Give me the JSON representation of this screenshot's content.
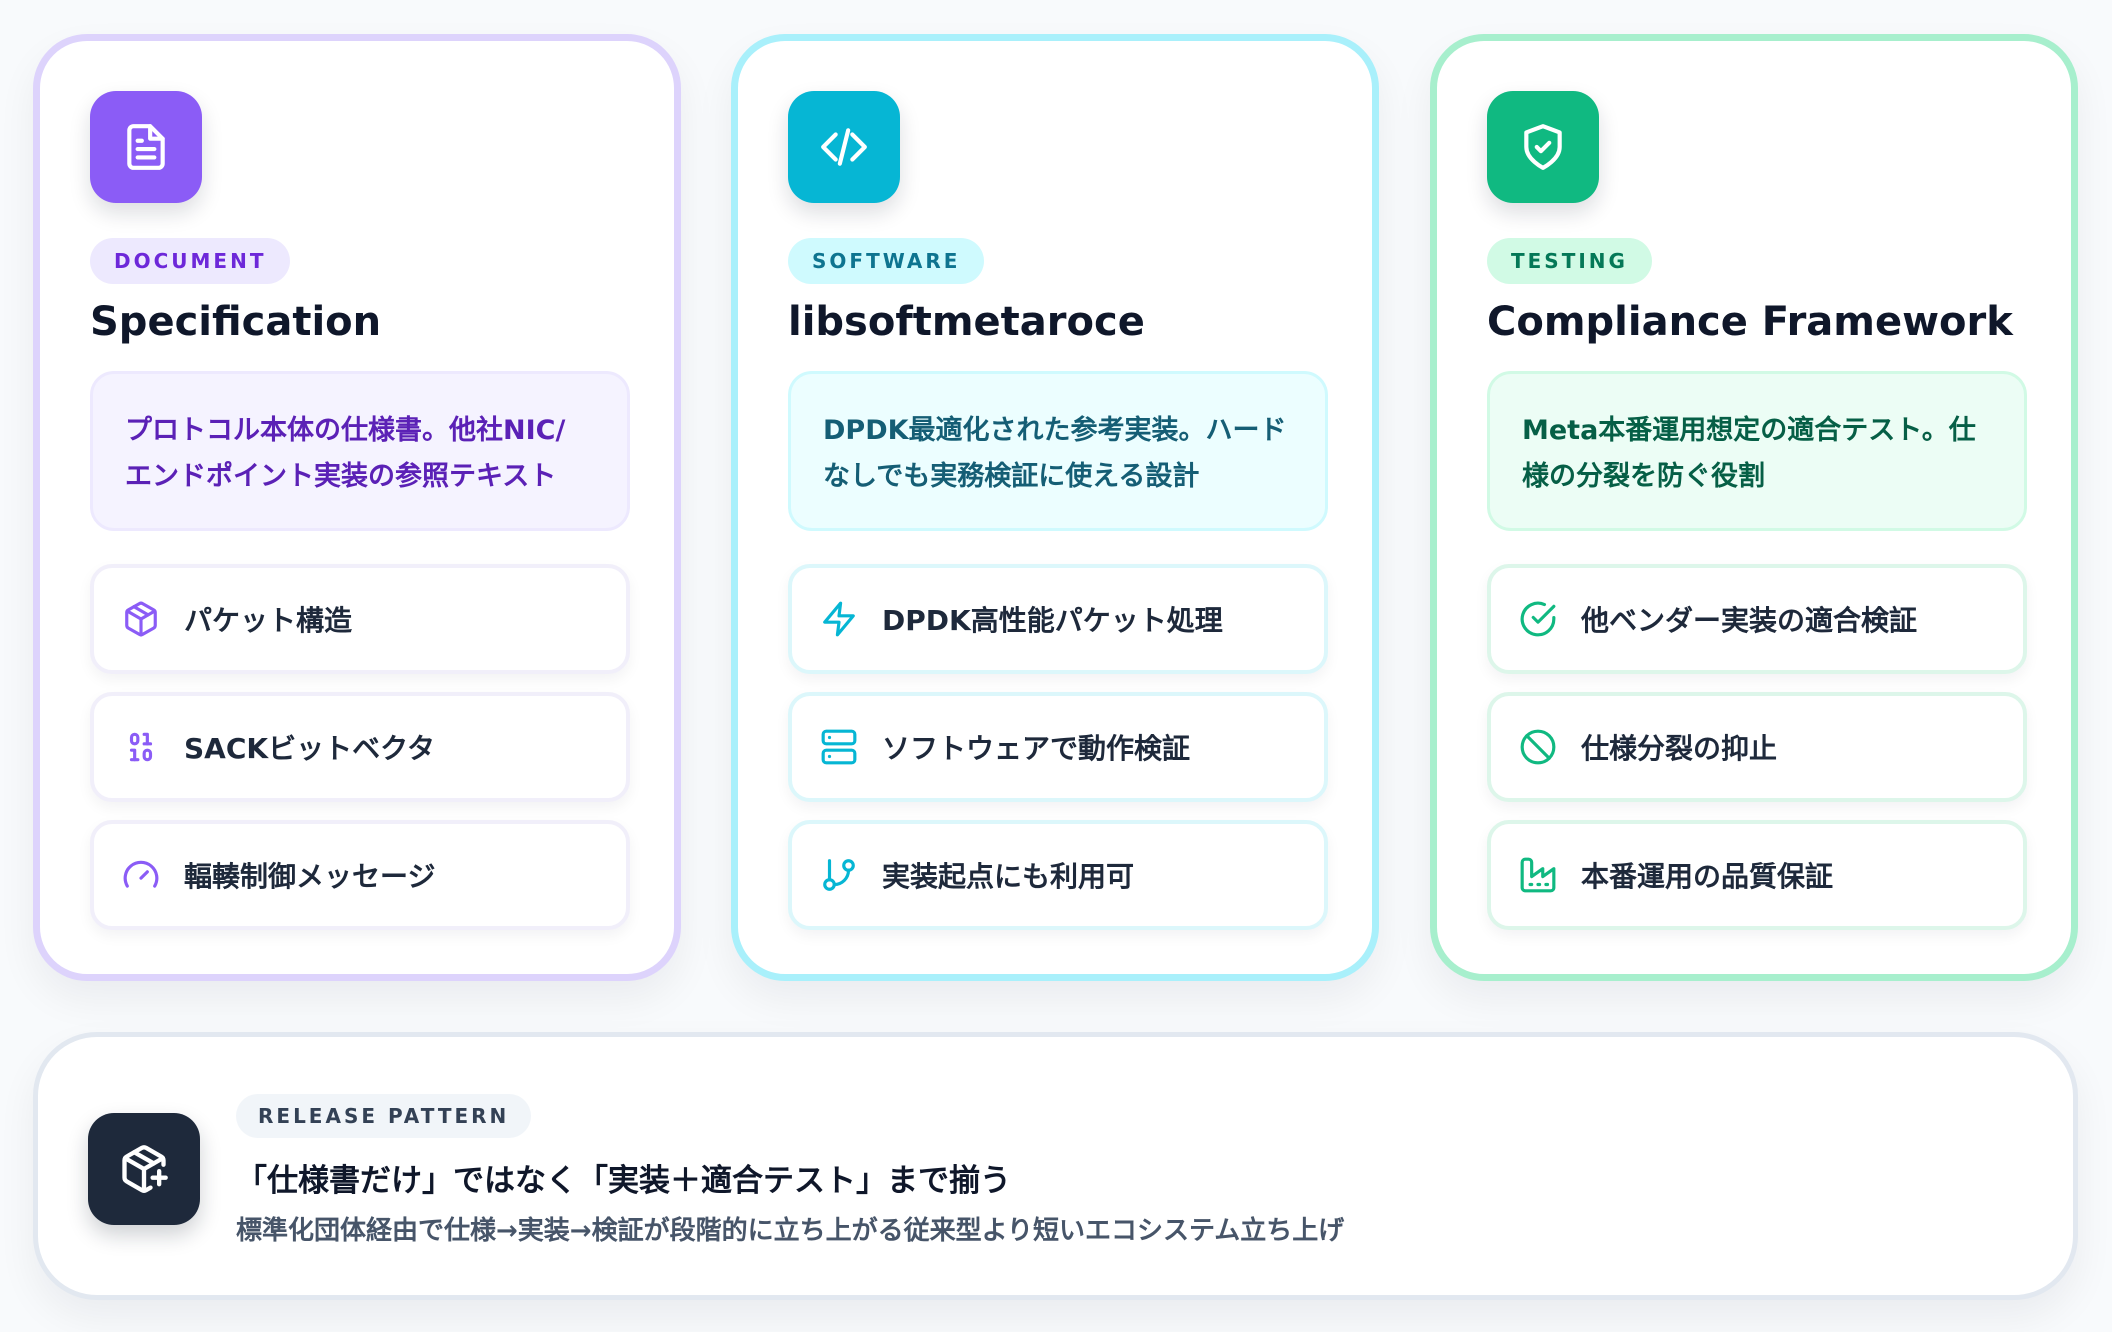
{
  "cards": [
    {
      "badge": "DOCUMENT",
      "title": "Specification",
      "description_line1": "プロトコル本体の仕様書。他社NIC/",
      "description_line2": "エンドポイント実装の参照テキスト",
      "features": [
        {
          "icon": "package-icon",
          "label": "パケット構造"
        },
        {
          "icon": "binary-icon",
          "label": "SACKビットベクタ"
        },
        {
          "icon": "gauge-icon",
          "label": "輻輳制御メッセージ"
        }
      ],
      "accent": "#8b5cf6"
    },
    {
      "badge": "SOFTWARE",
      "title": "libsoftmetaroce",
      "description_line1": "DPDK最適化された参考実装。ハード",
      "description_line2": "なしでも実務検証に使える設計",
      "features": [
        {
          "icon": "zap-icon",
          "label": "DPDK高性能パケット処理"
        },
        {
          "icon": "server-icon",
          "label": "ソフトウェアで動作検証"
        },
        {
          "icon": "git-branch-icon",
          "label": "実装起点にも利用可"
        }
      ],
      "accent": "#06b6d4"
    },
    {
      "badge": "TESTING",
      "title": "Compliance Framework",
      "description_line1": "Meta本番運用想定の適合テスト。仕",
      "description_line2": "様の分裂を防ぐ役割",
      "features": [
        {
          "icon": "check-circle-icon",
          "label": "他ベンダー実装の適合検証"
        },
        {
          "icon": "ban-icon",
          "label": "仕様分裂の抑止"
        },
        {
          "icon": "factory-icon",
          "label": "本番運用の品質保証"
        }
      ],
      "accent": "#10b981"
    }
  ],
  "release": {
    "badge": "RELEASE PATTERN",
    "headline": "「仕様書だけ」ではなく「実装＋適合テスト」まで揃う",
    "subtext": "標準化団体経由で仕様→実装→検証が段階的に立ち上がる従来型より短いエコシステム立ち上げ",
    "icon": "package-plus-icon"
  }
}
